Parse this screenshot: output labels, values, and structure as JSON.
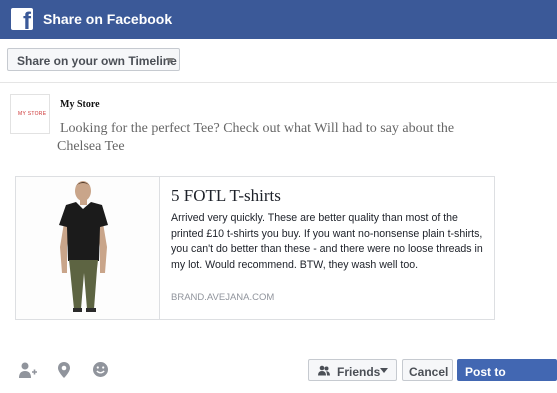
{
  "header": {
    "title": "Share on Facebook",
    "logo_icon": "facebook-logo-icon"
  },
  "share_target": {
    "selected": "Share on your own Timeline",
    "icon": "chevron-down-icon"
  },
  "post": {
    "author": "My Store",
    "logo_text": "MY STORE",
    "message": "Looking for the perfect Tee? Check out what Will had to say about the Chelsea Tee"
  },
  "link_card": {
    "title": "5 FOTL T-shirts",
    "description": "Arrived very quickly. These are better quality than most of the printed £10 t-shirts you buy. If you want no-nonsense plain t-shirts, you can't do better than these - and there were no loose threads in my lot. Would recommend. BTW, they wash well too.",
    "domain": "BRAND.AVEJANA.COM",
    "image": "man-in-black-tshirt-photo"
  },
  "footer": {
    "icons": [
      "tag-friends-icon",
      "location-pin-icon",
      "feeling-smiley-icon"
    ],
    "audience_label": "Friends",
    "cancel_label": "Cancel",
    "post_label": "Post to Facebook"
  },
  "colors": {
    "brand": "#3b5998",
    "primary_button": "#4267b2"
  }
}
